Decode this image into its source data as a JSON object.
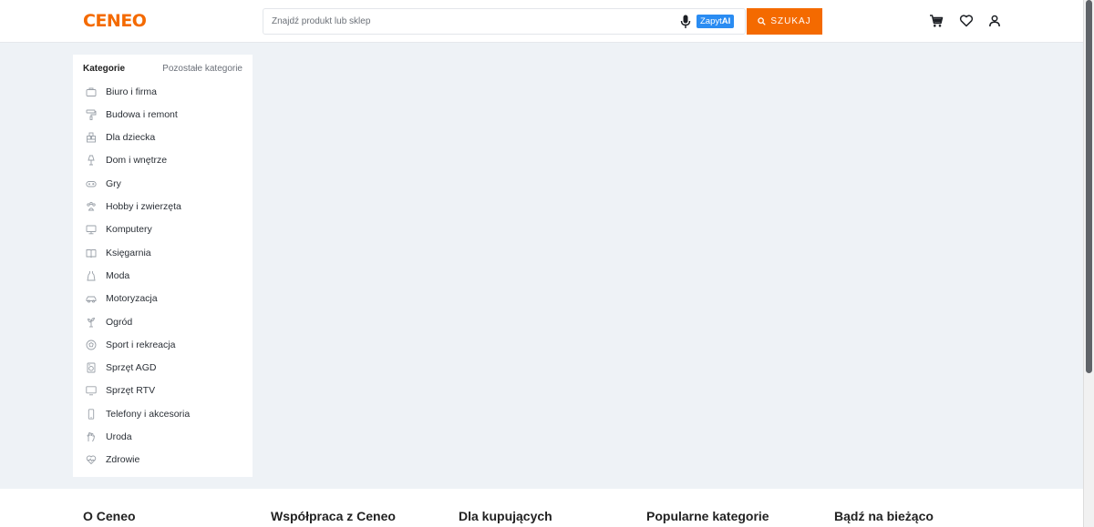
{
  "header": {
    "logo": "CENEO",
    "search_placeholder": "Znajdź produkt lub sklep",
    "zapyt_prefix": "Zapyt",
    "zapyt_suffix": "AI",
    "search_button": "SZUKAJ"
  },
  "sidebar": {
    "heading": "Kategorie",
    "other_link": "Pozostałe kategorie",
    "items": [
      {
        "label": "Biuro i firma",
        "icon": "briefcase-icon"
      },
      {
        "label": "Budowa i remont",
        "icon": "paint-roller-icon"
      },
      {
        "label": "Dla dziecka",
        "icon": "blocks-icon"
      },
      {
        "label": "Dom i wnętrze",
        "icon": "lamp-icon"
      },
      {
        "label": "Gry",
        "icon": "gamepad-icon"
      },
      {
        "label": "Hobby i zwierzęta",
        "icon": "paw-icon"
      },
      {
        "label": "Komputery",
        "icon": "monitor-icon"
      },
      {
        "label": "Księgarnia",
        "icon": "book-icon"
      },
      {
        "label": "Moda",
        "icon": "dress-icon"
      },
      {
        "label": "Motoryzacja",
        "icon": "car-icon"
      },
      {
        "label": "Ogród",
        "icon": "plant-icon"
      },
      {
        "label": "Sport i rekreacja",
        "icon": "ball-icon"
      },
      {
        "label": "Sprzęt AGD",
        "icon": "washing-machine-icon"
      },
      {
        "label": "Sprzęt RTV",
        "icon": "tv-icon"
      },
      {
        "label": "Telefony i akcesoria",
        "icon": "phone-icon"
      },
      {
        "label": "Uroda",
        "icon": "hand-icon"
      },
      {
        "label": "Zdrowie",
        "icon": "heart-pulse-icon"
      }
    ]
  },
  "footer": {
    "columns": [
      "O Ceneo",
      "Współpraca z Ceneo",
      "Dla kupujących",
      "Popularne kategorie",
      "Bądź na bieżąco"
    ]
  },
  "colors": {
    "brand": "#f46a00",
    "ai_badge": "#2a8cf2",
    "page_background": "#eef2f6"
  }
}
